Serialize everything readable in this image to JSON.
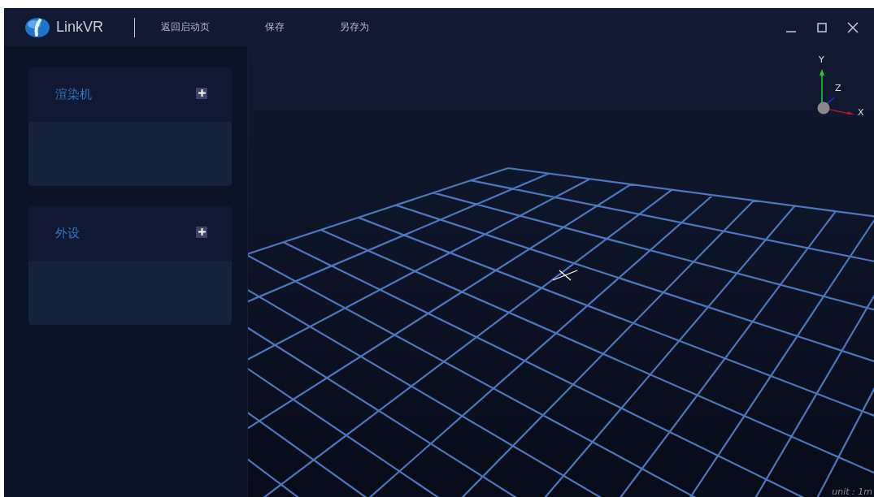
{
  "app": {
    "name": "LinkVR"
  },
  "menu": [
    {
      "label": "返回启动页"
    },
    {
      "label": "保存"
    },
    {
      "label": "另存为"
    }
  ],
  "panels": [
    {
      "title": "渲染机"
    },
    {
      "title": "外设"
    }
  ],
  "viewport": {
    "axes": {
      "y": "Y",
      "z": "Z",
      "x": "X"
    },
    "unit": "unit : 1m"
  }
}
